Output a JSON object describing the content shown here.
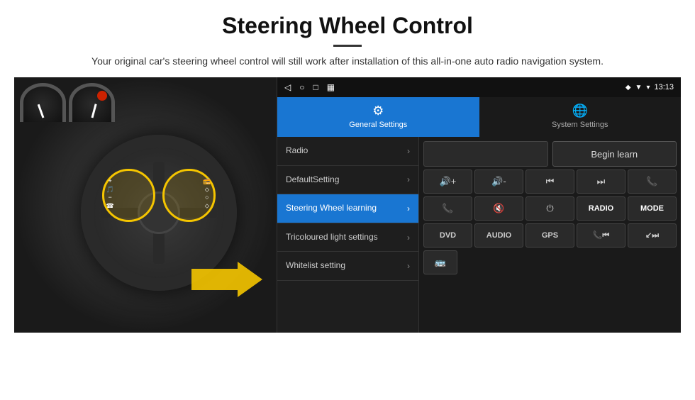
{
  "header": {
    "title": "Steering Wheel Control",
    "subtitle": "Your original car's steering wheel control will still work after installation of this all-in-one auto radio navigation system."
  },
  "android": {
    "status_bar": {
      "icons_left": [
        "◁",
        "○",
        "□",
        "▦"
      ],
      "time": "13:13",
      "signal_icon": "▼",
      "wifi_icon": "▾",
      "gps_icon": "◆"
    },
    "tabs": [
      {
        "label": "General Settings",
        "icon": "⚙",
        "active": true
      },
      {
        "label": "System Settings",
        "icon": "🌐",
        "active": false
      }
    ],
    "menu_items": [
      {
        "label": "Radio",
        "active": false
      },
      {
        "label": "DefaultSetting",
        "active": false
      },
      {
        "label": "Steering Wheel learning",
        "active": true
      },
      {
        "label": "Tricoloured light settings",
        "active": false
      },
      {
        "label": "Whitelist setting",
        "active": false
      }
    ],
    "begin_learn_label": "Begin learn",
    "controls_row1": [
      "🔊+",
      "🔊-",
      "⏮",
      "⏭",
      "📞"
    ],
    "controls_row2": [
      "📞",
      "🔇",
      "⏻",
      "RADIO",
      "MODE"
    ],
    "controls_row3_labels": [
      "DVD",
      "AUDIO",
      "GPS",
      "📞⏮",
      "↙⏭"
    ]
  }
}
